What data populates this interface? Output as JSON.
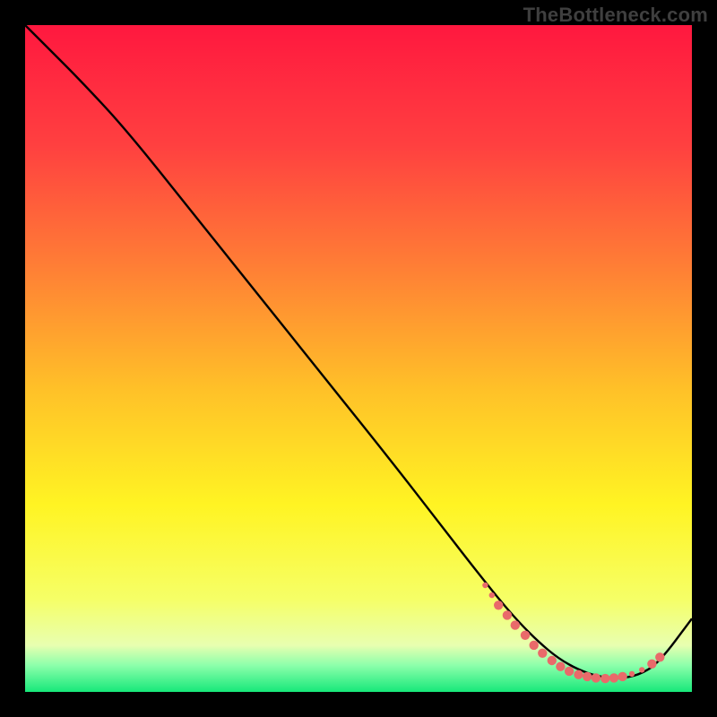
{
  "watermark": "TheBottleneck.com",
  "chart_data": {
    "type": "line",
    "title": "",
    "xlabel": "",
    "ylabel": "",
    "xlim": [
      0,
      100
    ],
    "ylim": [
      0,
      100
    ],
    "grid": false,
    "legend": false,
    "gradient_stops": [
      {
        "offset": 0,
        "color": "#ff183f"
      },
      {
        "offset": 18,
        "color": "#ff4040"
      },
      {
        "offset": 35,
        "color": "#ff7a36"
      },
      {
        "offset": 55,
        "color": "#ffc228"
      },
      {
        "offset": 72,
        "color": "#fff423"
      },
      {
        "offset": 86,
        "color": "#f6ff66"
      },
      {
        "offset": 93,
        "color": "#e8ffb0"
      },
      {
        "offset": 96,
        "color": "#8dffab"
      },
      {
        "offset": 100,
        "color": "#17e87a"
      }
    ],
    "series": [
      {
        "name": "curve",
        "stroke": "#000000",
        "x": [
          0,
          4,
          8,
          15,
          25,
          35,
          45,
          55,
          62,
          67,
          71,
          74,
          77,
          80,
          83,
          86,
          89,
          92,
          95,
          100
        ],
        "y": [
          100,
          96,
          92,
          84.5,
          72,
          59.5,
          47,
          34.5,
          25.5,
          19,
          14,
          10.5,
          7.5,
          5,
          3.3,
          2.3,
          2.0,
          2.5,
          4.3,
          11
        ]
      }
    ],
    "markers": {
      "name": "selected-range",
      "color": "#e96a6a",
      "radius_small": 3.2,
      "radius_large": 5.2,
      "points": [
        {
          "x": 69,
          "y": 16,
          "r": "small"
        },
        {
          "x": 70,
          "y": 14.5,
          "r": "small"
        },
        {
          "x": 71,
          "y": 13,
          "r": "large"
        },
        {
          "x": 72.3,
          "y": 11.5,
          "r": "large"
        },
        {
          "x": 73.5,
          "y": 10,
          "r": "large"
        },
        {
          "x": 75,
          "y": 8.5,
          "r": "large"
        },
        {
          "x": 76.3,
          "y": 7,
          "r": "large"
        },
        {
          "x": 77.6,
          "y": 5.8,
          "r": "large"
        },
        {
          "x": 79,
          "y": 4.7,
          "r": "large"
        },
        {
          "x": 80.3,
          "y": 3.8,
          "r": "large"
        },
        {
          "x": 81.6,
          "y": 3.1,
          "r": "large"
        },
        {
          "x": 83,
          "y": 2.6,
          "r": "large"
        },
        {
          "x": 84.3,
          "y": 2.3,
          "r": "large"
        },
        {
          "x": 85.6,
          "y": 2.1,
          "r": "large"
        },
        {
          "x": 87,
          "y": 2.0,
          "r": "large"
        },
        {
          "x": 88.3,
          "y": 2.1,
          "r": "large"
        },
        {
          "x": 89.6,
          "y": 2.3,
          "r": "large"
        },
        {
          "x": 91,
          "y": 2.7,
          "r": "small"
        },
        {
          "x": 92.5,
          "y": 3.3,
          "r": "small"
        },
        {
          "x": 94,
          "y": 4.2,
          "r": "large"
        },
        {
          "x": 95.2,
          "y": 5.2,
          "r": "large"
        }
      ]
    }
  }
}
